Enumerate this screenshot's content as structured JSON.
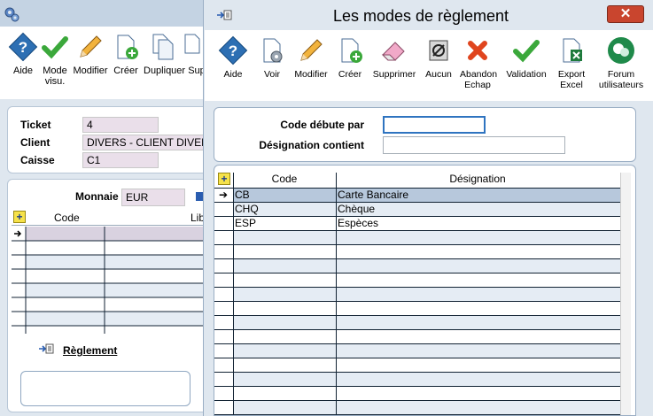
{
  "background_window": {
    "toolbar": [
      {
        "label": "Aide",
        "icon": "help-icon"
      },
      {
        "label": "Mode visu.",
        "icon": "check-icon"
      },
      {
        "label": "Modifier",
        "icon": "pencil-icon"
      },
      {
        "label": "Créer",
        "icon": "create-icon"
      },
      {
        "label": "Dupliquer",
        "icon": "duplicate-icon"
      },
      {
        "label": "Sup",
        "icon": "delete-icon"
      }
    ],
    "fields": [
      {
        "label": "Ticket",
        "value": "4"
      },
      {
        "label": "Client",
        "value": "DIVERS - CLIENT DIVERS"
      },
      {
        "label": "Caisse",
        "value": "C1"
      }
    ],
    "monnaie_label": "Monnaie",
    "monnaie_value": "EUR",
    "grid_headers": {
      "code": "Code",
      "libelle": "Lib"
    },
    "reglement_link": "Règlement"
  },
  "dialog": {
    "title": "Les modes de règlement",
    "close_label": "✕",
    "toolbar": [
      {
        "label": "Aide",
        "icon": "help-icon"
      },
      {
        "label": "Voir",
        "icon": "view-icon"
      },
      {
        "label": "Modifier",
        "icon": "pencil-icon"
      },
      {
        "label": "Créer",
        "icon": "create-icon"
      },
      {
        "label": "Supprimer",
        "icon": "eraser-icon"
      },
      {
        "label": "Aucun",
        "icon": "none-icon"
      },
      {
        "label": "Abandon Echap",
        "icon": "cancel-icon"
      },
      {
        "label": "Validation",
        "icon": "check-icon"
      },
      {
        "label": "Export Excel",
        "icon": "excel-icon"
      },
      {
        "label": "Forum utilisateurs",
        "icon": "forum-icon"
      }
    ],
    "filters": {
      "code_label": "Code débute par",
      "code_value": "",
      "designation_label": "Désignation contient",
      "designation_value": ""
    },
    "grid": {
      "headers": {
        "code": "Code",
        "designation": "Désignation"
      },
      "rows": [
        {
          "code": "CB",
          "designation": "Carte Bancaire",
          "selected": true
        },
        {
          "code": "CHQ",
          "designation": "Chèque",
          "selected": false
        },
        {
          "code": "ESP",
          "designation": "Espèces",
          "selected": false
        }
      ]
    }
  },
  "colors": {
    "selected_row": "#b7c8dc",
    "alt_row": "#e5ecf4",
    "field_bg": "#eadfea",
    "close_button": "#c9452e"
  }
}
